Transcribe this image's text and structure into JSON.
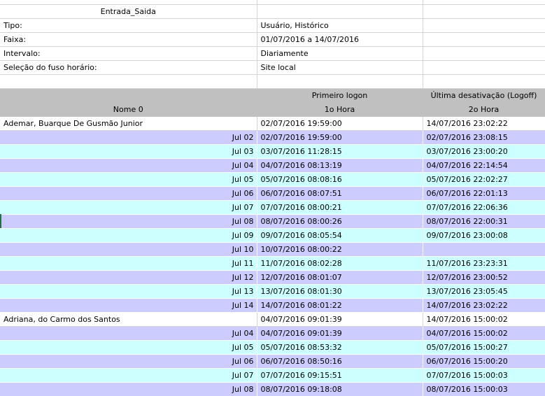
{
  "meta": {
    "report_title": "Entrada_Saida",
    "rows": [
      {
        "label": "Tipo:",
        "value": "Usuário, Histórico"
      },
      {
        "label": "Faixa:",
        "value": "01/07/2016 a 14/07/2016"
      },
      {
        "label": "Intervalo:",
        "value": "Diariamente"
      },
      {
        "label": "Seleção do fuso horário:",
        "value": "Site local"
      }
    ]
  },
  "header": {
    "col1_top": "",
    "col1_bottom": "Nome 0",
    "col2_top": "Primeiro logon",
    "col2_bottom": "1o Hora",
    "col3_top": "Última desativação (Logoff)",
    "col3_bottom": "2o Hora"
  },
  "rows": [
    {
      "type": "person",
      "name": "Ademar, Buarque De Gusmão Junior",
      "first": "02/07/2016 19:59:00",
      "last": "14/07/2016 23:02:22"
    },
    {
      "type": "day",
      "day": "Jul 02",
      "first": "02/07/2016 19:59:00",
      "last": "02/07/2016 23:08:15"
    },
    {
      "type": "day",
      "day": "Jul 03",
      "first": "03/07/2016 11:28:15",
      "last": "03/07/2016 23:00:20"
    },
    {
      "type": "day",
      "day": "Jul 04",
      "first": "04/07/2016 08:13:19",
      "last": "04/07/2016 22:14:54"
    },
    {
      "type": "day",
      "day": "Jul 05",
      "first": "05/07/2016 08:08:16",
      "last": "05/07/2016 22:02:27"
    },
    {
      "type": "day",
      "day": "Jul 06",
      "first": "06/07/2016 08:07:51",
      "last": "06/07/2016 22:01:13"
    },
    {
      "type": "day",
      "day": "Jul 07",
      "first": "07/07/2016 08:00:21",
      "last": "07/07/2016 22:06:36"
    },
    {
      "type": "day",
      "day": "Jul 08",
      "first": "08/07/2016 08:00:26",
      "last": "08/07/2016 22:00:31"
    },
    {
      "type": "day",
      "day": "Jul 09",
      "first": "09/07/2016 08:05:54",
      "last": "09/07/2016 23:00:08"
    },
    {
      "type": "day",
      "day": "Jul 10",
      "first": "10/07/2016 08:00:22",
      "last": ""
    },
    {
      "type": "day",
      "day": "Jul 11",
      "first": "11/07/2016 08:02:28",
      "last": "11/07/2016 23:23:31"
    },
    {
      "type": "day",
      "day": "Jul 12",
      "first": "12/07/2016 08:01:07",
      "last": "12/07/2016 23:00:52"
    },
    {
      "type": "day",
      "day": "Jul 13",
      "first": "13/07/2016 08:01:30",
      "last": "13/07/2016 23:05:45"
    },
    {
      "type": "day",
      "day": "Jul 14",
      "first": "14/07/2016 08:01:22",
      "last": "14/07/2016 23:02:22"
    },
    {
      "type": "person",
      "name": "Adriana, do Carmo dos Santos",
      "first": "04/07/2016 09:01:39",
      "last": "14/07/2016 15:00:02"
    },
    {
      "type": "day",
      "day": "Jul 04",
      "first": "04/07/2016 09:01:39",
      "last": "04/07/2016 15:00:02"
    },
    {
      "type": "day",
      "day": "Jul 05",
      "first": "05/07/2016 08:53:32",
      "last": "05/07/2016 15:00:27"
    },
    {
      "type": "day",
      "day": "Jul 06",
      "first": "06/07/2016 08:50:16",
      "last": "06/07/2016 15:00:20"
    },
    {
      "type": "day",
      "day": "Jul 07",
      "first": "07/07/2016 09:15:51",
      "last": "07/07/2016 15:00:03"
    },
    {
      "type": "day",
      "day": "Jul 08",
      "first": "08/07/2016 09:18:08",
      "last": "08/07/2016 15:00:03"
    }
  ],
  "colors": {
    "header_bg": "#c0c0c0",
    "row_purple": "#ccccff",
    "row_cyan": "#ccffff",
    "gridline": "#d4d4d4"
  }
}
